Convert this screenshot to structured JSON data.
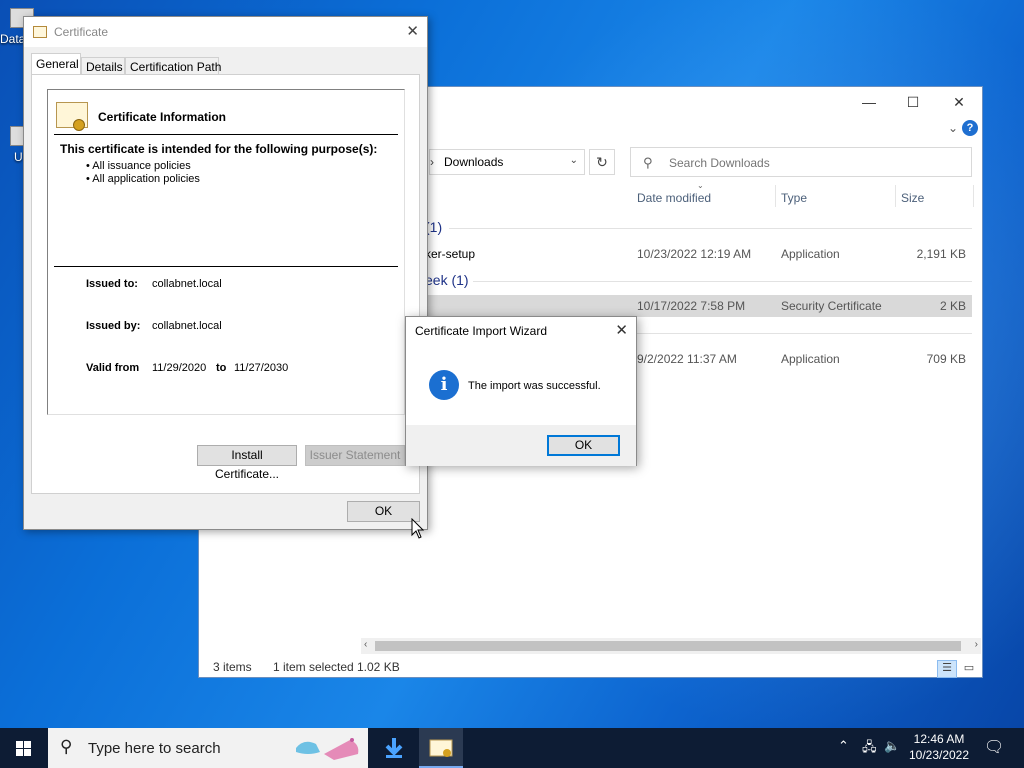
{
  "desktop": {
    "icons": [
      {
        "label": "Data"
      },
      {
        "label": "U"
      }
    ]
  },
  "explorer": {
    "breadcrumb": "Downloads",
    "search_placeholder": "Search Downloads",
    "columns": {
      "date": "Date modified",
      "type": "Type",
      "size": "Size"
    },
    "groups": [
      {
        "label": "(1)"
      },
      {
        "label": "eek (1)"
      }
    ],
    "rows": [
      {
        "name": "ker-setup",
        "date": "10/23/2022 12:19 AM",
        "type": "Application",
        "size": "2,191 KB"
      },
      {
        "name": "",
        "date": "10/17/2022 7:58 PM",
        "type": "Security Certificate",
        "size": "2 KB"
      },
      {
        "name": "",
        "date": "9/2/2022 11:37 AM",
        "type": "Application",
        "size": "709 KB"
      }
    ],
    "status": {
      "items": "3 items",
      "selected": "1 item selected",
      "size": "1.02 KB"
    }
  },
  "certificate": {
    "title": "Certificate",
    "tabs": [
      "General",
      "Details",
      "Certification Path"
    ],
    "info_title": "Certificate Information",
    "purpose_heading": "This certificate is intended for the following purpose(s):",
    "purposes": [
      "• All issuance policies",
      "• All application policies"
    ],
    "issued_to_label": "Issued to:",
    "issued_to": "collabnet.local",
    "issued_by_label": "Issued by:",
    "issued_by": "collabnet.local",
    "valid_from_label": "Valid from",
    "valid_from": "11/29/2020",
    "to_label": "to",
    "valid_to": "11/27/2030",
    "install_button": "Install Certificate...",
    "issuer_statement_button": "Issuer Statement",
    "ok_button": "OK"
  },
  "wizard": {
    "title": "Certificate Import Wizard",
    "message": "The import was successful.",
    "ok_button": "OK",
    "info_glyph": "i"
  },
  "taskbar": {
    "search_placeholder": "Type here to search",
    "time": "12:46 AM",
    "date": "10/23/2022"
  },
  "colors": {
    "accent": "#0078d7",
    "taskbar": "#0d1c34",
    "info_blue": "#1b6fd1"
  }
}
